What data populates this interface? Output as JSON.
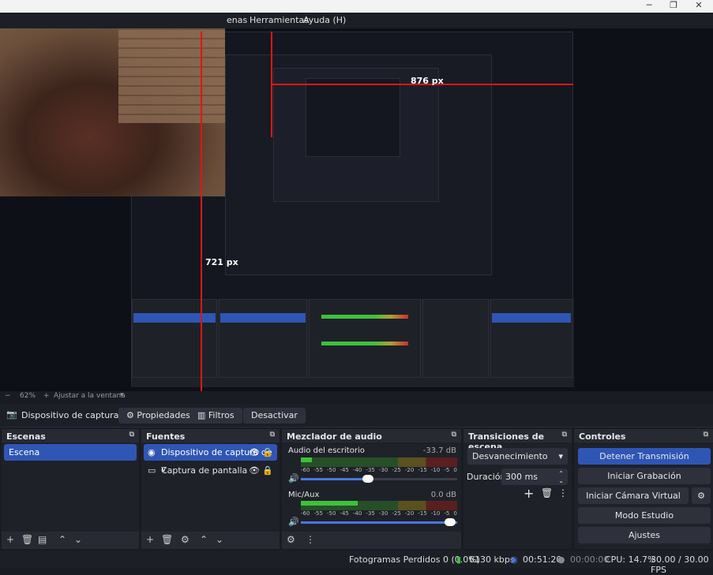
{
  "window": {
    "minimize": "─",
    "restore": "❐",
    "close": "✕"
  },
  "menu": {
    "items": [
      "enas",
      "Herramientas",
      "Ayuda (H)"
    ]
  },
  "preview": {
    "label_px_top": "876 px",
    "label_px_bottom": "721 px"
  },
  "zoom": {
    "percent": "62%",
    "fit_label": "Ajustar a la ventana"
  },
  "source_bar": {
    "source_name": "Dispositivo de captura de v",
    "properties": "Propiedades",
    "filters": "Filtros",
    "deactivate": "Desactivar"
  },
  "scenes": {
    "title": "Escenas",
    "items": [
      "Escena"
    ]
  },
  "sources": {
    "title": "Fuentes",
    "items": [
      "Dispositivo de captura de v",
      "Captura de pantalla"
    ]
  },
  "mixer": {
    "title": "Mezclador de audio",
    "channels": [
      {
        "name": "Audio del escritorio",
        "db": "-33.7 dB",
        "level": 0.07,
        "volume": 0.42
      },
      {
        "name": "Mic/Aux",
        "db": "0.0 dB",
        "level": 0.55,
        "volume": 1.0
      }
    ],
    "ticks": [
      "-60",
      "-55",
      "-50",
      "-45",
      "-40",
      "-35",
      "-30",
      "-25",
      "-20",
      "-15",
      "-10",
      "-5",
      "0"
    ]
  },
  "transitions": {
    "title": "Transiciones de escena",
    "type": "Desvanecimiento",
    "duration_label": "Duración",
    "duration_value": "300 ms"
  },
  "controls": {
    "title": "Controles",
    "buttons": [
      "Detener Transmisión",
      "Iniciar Grabación",
      "Iniciar Cámara Virtual",
      "Modo Estudio",
      "Ajustes"
    ]
  },
  "status": {
    "dropped": "Fotogramas Perdidos 0 (0.0%)",
    "bitrate": "6130 kbps",
    "stream_time": "00:51:20",
    "rec_time": "00:00:00",
    "cpu": "CPU: 14.7%",
    "fps": "30.00 / 30.00 FPS"
  },
  "colors": {
    "accent": "#2f56b5",
    "red_guide": "#e01515",
    "meter_green": "#3cc23c",
    "meter_yellow": "#b0a030",
    "meter_red": "#c83030"
  }
}
